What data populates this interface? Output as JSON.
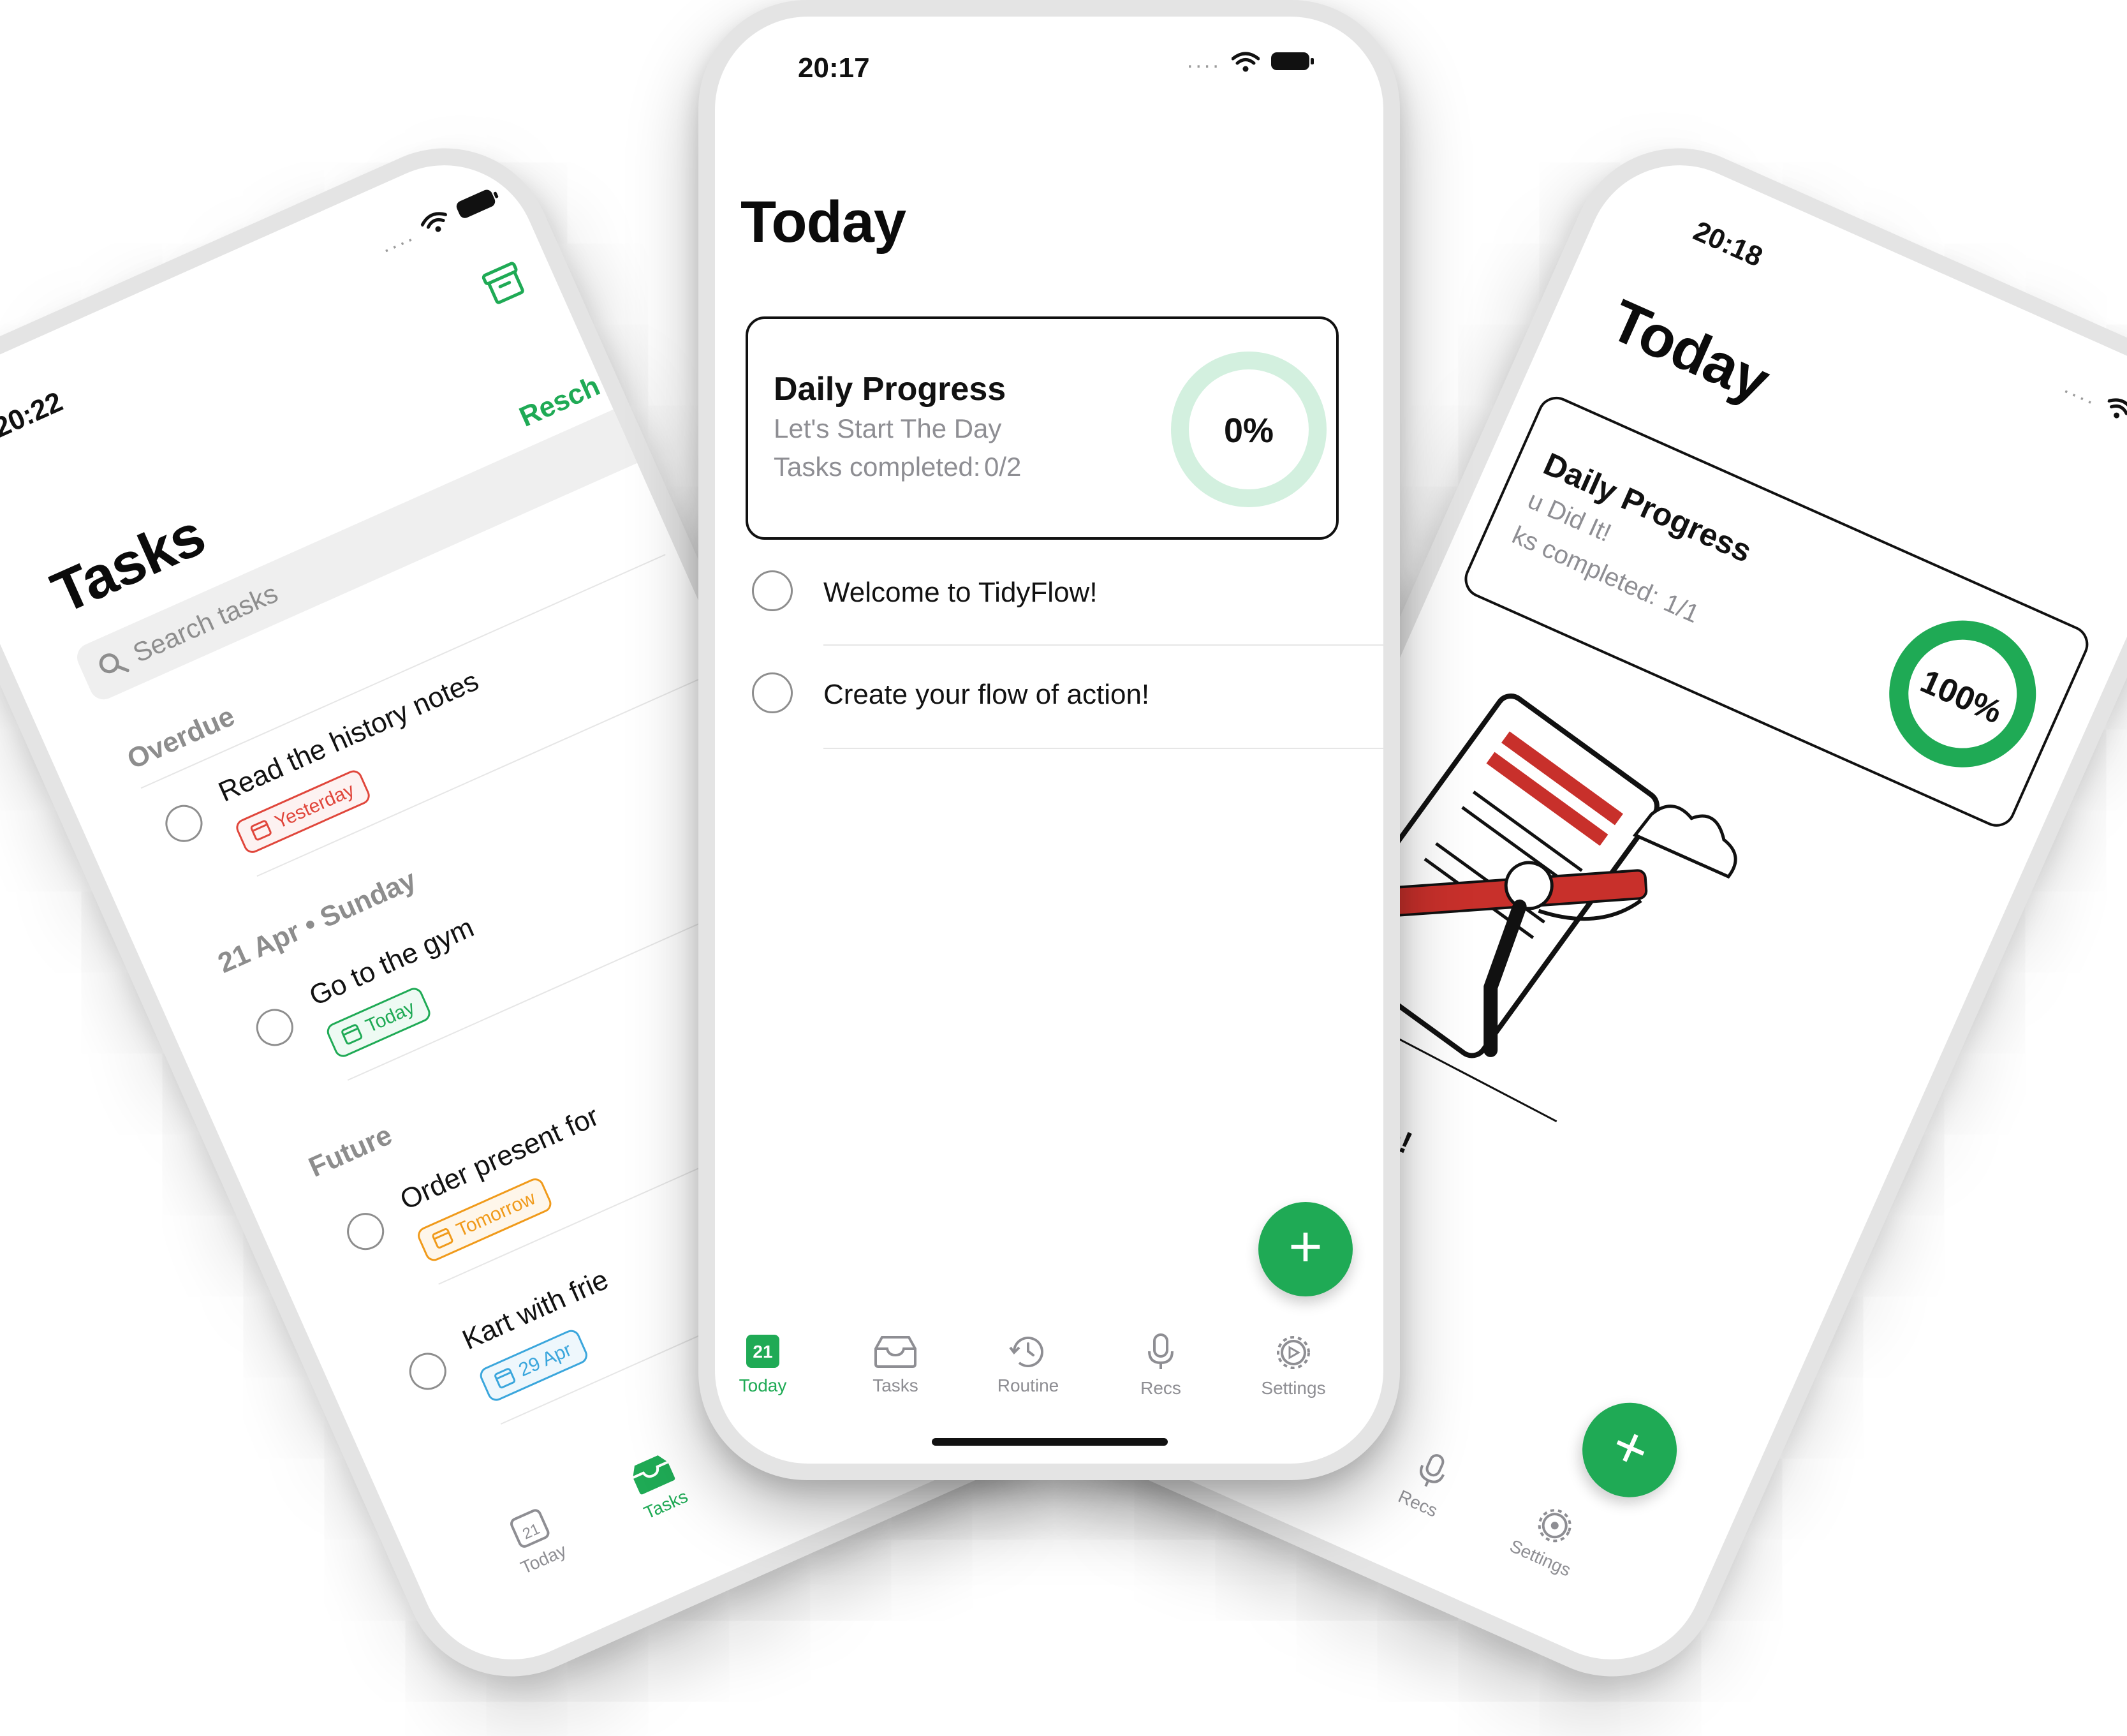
{
  "left_phone": {
    "time": "20:22",
    "status_dots": "....",
    "title": "Tasks",
    "search_placeholder": "Search tasks",
    "reschedule_label": "Resch",
    "sections": [
      {
        "label": "Overdue",
        "tasks": [
          {
            "title": "Read the history notes",
            "chip": "Yesterday",
            "chip_color": "#e0463b"
          }
        ]
      },
      {
        "label": "21 Apr • Sunday",
        "tasks": [
          {
            "title": "Go to the gym",
            "chip": "Today",
            "chip_color": "#1faa55"
          }
        ]
      },
      {
        "label": "Future",
        "tasks": [
          {
            "title": "Order present for",
            "chip": "Tomorrow",
            "chip_color": "#f09a1a"
          },
          {
            "title": "Kart with frie",
            "chip": "29 Apr",
            "chip_color": "#3aa6dc"
          }
        ]
      }
    ],
    "tabs": [
      {
        "label": "Today",
        "badge": "21"
      },
      {
        "label": "Tasks"
      }
    ]
  },
  "center_phone": {
    "time": "20:17",
    "status_dots": "....",
    "title": "Today",
    "progress_card": {
      "heading": "Daily Progress",
      "subtitle": "Let's Start The Day",
      "completed_label": "Tasks completed:",
      "completed_value": "0/2",
      "percent_text": "0%",
      "percent": 0
    },
    "tasks": [
      {
        "title": "Welcome to TidyFlow!"
      },
      {
        "title": "Create your flow of action!"
      }
    ],
    "fab_symbol": "+",
    "tabs": [
      {
        "label": "Today",
        "badge": "21",
        "active": true
      },
      {
        "label": "Tasks"
      },
      {
        "label": "Routine"
      },
      {
        "label": "Recs"
      },
      {
        "label": "Settings"
      }
    ]
  },
  "right_phone": {
    "time": "20:18",
    "status_dots": "....",
    "title": "Today",
    "progress_card": {
      "heading": "Daily Progress",
      "subtitle": "u Did It!",
      "completed_label": "ks completed:",
      "completed_value": "1/1",
      "percent_text": "100%",
      "percent": 100
    },
    "done_text": ": Done!",
    "fab_symbol": "+",
    "tabs": [
      {
        "label": "Recs"
      },
      {
        "label": "Settings"
      }
    ]
  },
  "colors": {
    "accent": "#1faa55",
    "accent_light": "#d3f0df",
    "text": "#111111",
    "muted": "#8e8e93"
  }
}
